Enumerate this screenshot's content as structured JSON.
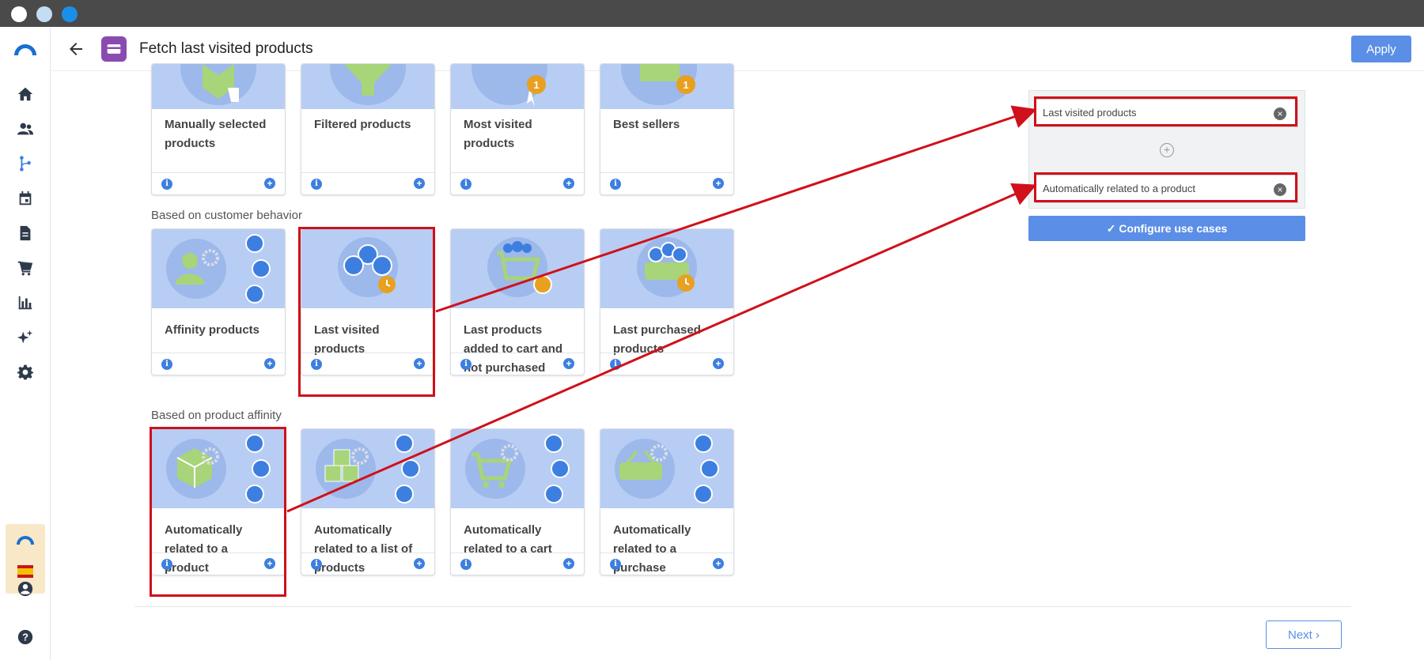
{
  "window": {
    "dots": [
      "#ffffff",
      "#c4dcf4",
      "#1a8fe8"
    ]
  },
  "header": {
    "title": "Fetch last visited products",
    "apply_label": "Apply"
  },
  "sidebar": {
    "items": [
      {
        "name": "home-icon"
      },
      {
        "name": "users-icon"
      },
      {
        "name": "flow-icon",
        "active": true
      },
      {
        "name": "calendar-icon"
      },
      {
        "name": "document-icon"
      },
      {
        "name": "cart-icon"
      },
      {
        "name": "chart-icon"
      },
      {
        "name": "sparkle-icon"
      },
      {
        "name": "gear-icon"
      }
    ]
  },
  "sections": {
    "customer_behavior": "Based on customer behavior",
    "product_affinity": "Based on product affinity"
  },
  "tiles": {
    "row1": [
      "Manually selected products",
      "Filtered products",
      "Most visited products",
      "Best sellers"
    ],
    "row2": [
      "Affinity products",
      "Last visited products",
      "Last products added to cart and not purchased",
      "Last purchased products"
    ],
    "row3": [
      "Automatically related to a product",
      "Automatically related to a list of products",
      "Automatically related to a cart",
      "Automatically related to a purchase"
    ]
  },
  "panel": {
    "slots": [
      "Last visited products",
      "Automatically related to a product"
    ],
    "configure_label": "Configure use cases"
  },
  "footer": {
    "next_label": "Next"
  },
  "colors": {
    "accent": "#5b8ee6",
    "highlight": "#d0101a",
    "tile_bg": "#b8cdf3"
  }
}
